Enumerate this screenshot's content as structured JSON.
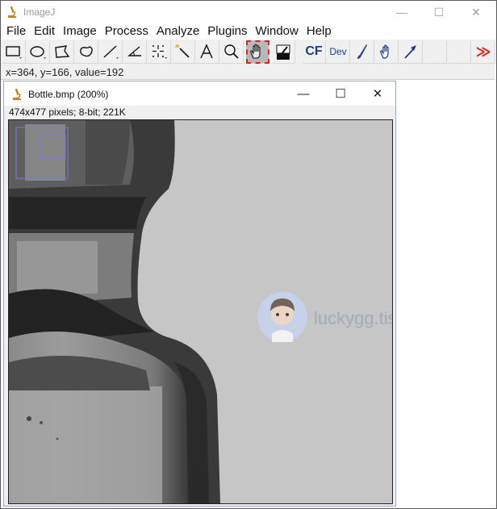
{
  "main_window": {
    "title": "ImageJ",
    "controls": {
      "minimize": "—",
      "maximize": "☐",
      "close": "✕"
    },
    "menu": [
      "File",
      "Edit",
      "Image",
      "Process",
      "Analyze",
      "Plugins",
      "Window",
      "Help"
    ],
    "toolbar": {
      "tools": [
        {
          "name": "rectangle-tool",
          "icon": "rectangle-icon"
        },
        {
          "name": "oval-tool",
          "icon": "oval-icon"
        },
        {
          "name": "polygon-tool",
          "icon": "polygon-icon"
        },
        {
          "name": "freehand-tool",
          "icon": "freehand-icon"
        },
        {
          "name": "line-tool",
          "icon": "line-icon"
        },
        {
          "name": "angle-tool",
          "icon": "angle-icon"
        },
        {
          "name": "point-tool",
          "icon": "point-icon"
        },
        {
          "name": "wand-tool",
          "icon": "wand-icon"
        },
        {
          "name": "text-tool",
          "icon": "text-icon"
        },
        {
          "name": "magnifier-tool",
          "icon": "magnifier-icon"
        },
        {
          "name": "hand-tool",
          "icon": "hand-icon",
          "selected": true
        },
        {
          "name": "color-picker-tool",
          "icon": "dropper-icon"
        }
      ],
      "cf_label": "CF",
      "dev_label": "Dev",
      "more_label": "≫"
    },
    "status": "x=364, y=166, value=192"
  },
  "image_window": {
    "title": "Bottle.bmp (200%)",
    "controls": {
      "minimize": "—",
      "maximize": "☐",
      "close": "✕"
    },
    "info": "474x477 pixels; 8-bit; 221K"
  },
  "watermark": {
    "text": "luckygg.tistory.com"
  },
  "colors": {
    "selection_outline": "#d9261c",
    "tool_blue": "#1a3e8c",
    "canvas_gray": "#c6c6c6"
  }
}
